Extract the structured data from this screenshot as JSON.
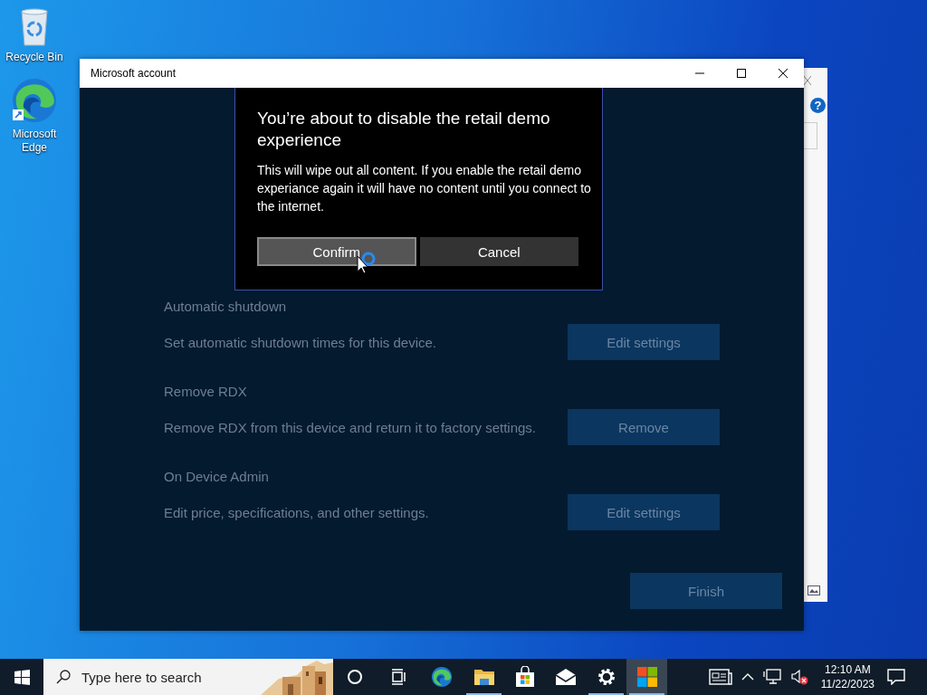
{
  "desktop": {
    "icons": [
      {
        "kind": "recycle-bin",
        "label": "Recycle Bin"
      },
      {
        "kind": "edge",
        "label": "Microsoft Edge"
      }
    ]
  },
  "back_window": {
    "help": "?"
  },
  "window": {
    "title": "Microsoft account"
  },
  "dialog": {
    "title": "You’re about to disable the retail demo experience",
    "message": "This will wipe out all content. If you enable the retail demo experiance again it will have no content until you connect to the internet.",
    "buttons": [
      {
        "label": "Confirm",
        "focused": true
      },
      {
        "label": "Cancel",
        "focused": false
      }
    ]
  },
  "sections": [
    {
      "heading": "Automatic shutdown",
      "description": "Set automatic shutdown times for this device.",
      "button": "Edit settings"
    },
    {
      "heading": "Remove RDX",
      "description": "Remove RDX from this device and return it to factory settings.",
      "button": "Remove"
    },
    {
      "heading": "On Device Admin",
      "description": "Edit price, specifications, and other settings.",
      "button": "Edit settings"
    }
  ],
  "finish_button": "Finish",
  "taskbar": {
    "search": {
      "placeholder": "Type here to search"
    },
    "apps": [
      {
        "kind": "edge",
        "running": false,
        "active": false
      },
      {
        "kind": "explorer",
        "running": true,
        "active": false
      },
      {
        "kind": "store",
        "running": false,
        "active": false
      },
      {
        "kind": "mail",
        "running": false,
        "active": false
      },
      {
        "kind": "settings",
        "running": true,
        "active": false
      },
      {
        "kind": "retail",
        "running": true,
        "active": true
      }
    ],
    "time": "12:10 AM",
    "date": "11/22/2023"
  }
}
